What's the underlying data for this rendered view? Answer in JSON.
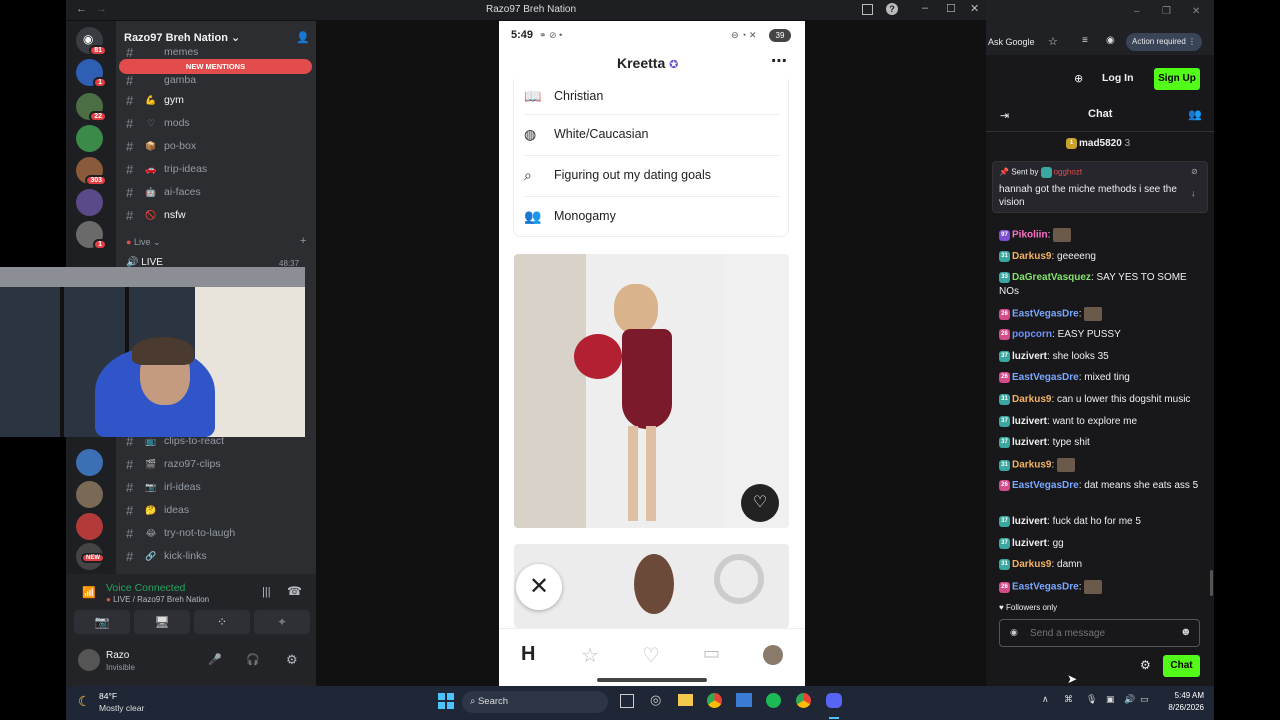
{
  "discord": {
    "window_title": "Razo97 Breh Nation",
    "server_name": "Razo97 Breh Nation",
    "new_mentions": "NEW MENTIONS",
    "guild_badges": [
      "81",
      "1",
      "22",
      "303",
      "1",
      "NEW"
    ],
    "channels_top": [
      {
        "name": "memes",
        "emoji": "",
        "bright": false
      },
      {
        "name": "gamba",
        "emoji": "",
        "bright": false
      },
      {
        "name": "gym",
        "emoji": "💪",
        "bright": true
      },
      {
        "name": "mods",
        "emoji": "♡",
        "bright": false
      },
      {
        "name": "po-box",
        "emoji": "📦",
        "bright": false
      },
      {
        "name": "trip-ideas",
        "emoji": "🚗",
        "bright": false
      },
      {
        "name": "ai-faces",
        "emoji": "🤖",
        "bright": false
      },
      {
        "name": "nsfw",
        "emoji": "🚫",
        "bright": true
      }
    ],
    "category_live": "Live",
    "live_channel": "LIVE",
    "live_time": "48:37",
    "channels_bottom": [
      {
        "name": "clips-to-react",
        "emoji": "📺"
      },
      {
        "name": "razo97-clips",
        "emoji": "🎬"
      },
      {
        "name": "irl-ideas",
        "emoji": "📷"
      },
      {
        "name": "ideas",
        "emoji": "🤔"
      },
      {
        "name": "try-not-to-laugh",
        "emoji": "😂"
      },
      {
        "name": "kick-links",
        "emoji": "🔗"
      }
    ],
    "voice_status": "Voice Connected",
    "voice_channel": "LIVE / Razo97 Breh Nation",
    "user_name": "Razo",
    "user_status": "Invisible"
  },
  "phone": {
    "time": "5:49",
    "battery": "39",
    "profile_name": "Kreetta",
    "details": [
      {
        "icon": "book-icon",
        "text": "Christian"
      },
      {
        "icon": "globe-icon",
        "text": "White/Caucasian"
      },
      {
        "icon": "search-icon",
        "text": "Figuring out my dating goals"
      },
      {
        "icon": "people-icon",
        "text": "Monogamy"
      }
    ]
  },
  "browser": {
    "ask_google": "Ask Google",
    "action_required": "Action required",
    "log_in": "Log In",
    "sign_up": "Sign Up",
    "chat_title": "Chat",
    "top_gifter": "mad5820",
    "top_gifter_count": "3",
    "pinned_sent_by": "Sent by",
    "pinned_user": "ogghozt",
    "pinned_text": "hannah got the miche methods i see the vision",
    "messages": [
      {
        "badge": "97",
        "user": "Pikoliin",
        "color": "#ff6ec7",
        "text": ""
      },
      {
        "badge": "31",
        "user": "Darkus9",
        "color": "#f3b35f",
        "text": "geeeeng"
      },
      {
        "badge": "33",
        "user": "DaGreatVasquez",
        "color": "#84e36b",
        "text": "SAY YES TO SOME NOs"
      },
      {
        "badge": "26",
        "user": "EastVegasDre",
        "color": "#7aa8ff",
        "text": ""
      },
      {
        "badge": "26",
        "user": "popcorn",
        "color": "#6f8fff",
        "text": "EASY PUSSY"
      },
      {
        "badge": "37",
        "user": "luzivert",
        "color": "#efeff1",
        "text": "she looks 35"
      },
      {
        "badge": "26",
        "user": "EastVegasDre",
        "color": "#7aa8ff",
        "text": "mixed ting"
      },
      {
        "badge": "31",
        "user": "Darkus9",
        "color": "#f3b35f",
        "text": "can u lower this dogshit music"
      },
      {
        "badge": "37",
        "user": "luzivert",
        "color": "#efeff1",
        "text": "want to explore me"
      },
      {
        "badge": "37",
        "user": "luzivert",
        "color": "#efeff1",
        "text": "type shit"
      },
      {
        "badge": "31",
        "user": "Darkus9",
        "color": "#f3b35f",
        "text": ""
      },
      {
        "badge": "26",
        "user": "EastVegasDre",
        "color": "#7aa8ff",
        "text": "dat means she eats ass 5"
      },
      {
        "badge": "37",
        "user": "luzivert",
        "color": "#efeff1",
        "text": "fuck dat ho for me 5"
      },
      {
        "badge": "37",
        "user": "luzivert",
        "color": "#efeff1",
        "text": "gg"
      },
      {
        "badge": "31",
        "user": "Darkus9",
        "color": "#f3b35f",
        "text": "damn"
      },
      {
        "badge": "26",
        "user": "EastVegasDre",
        "color": "#7aa8ff",
        "text": ""
      }
    ],
    "followers_only": "Followers only",
    "send_placeholder": "Send a message",
    "chat_button": "Chat"
  },
  "taskbar": {
    "weather_temp": "84°F",
    "weather_desc": "Mostly clear",
    "search": "Search",
    "time": "5:49 AM",
    "date": "8/26/2026"
  }
}
